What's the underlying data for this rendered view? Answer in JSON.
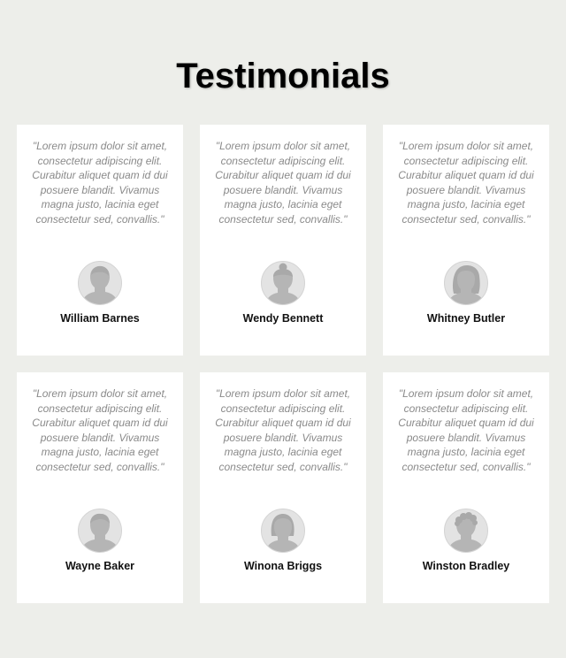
{
  "page": {
    "title": "Testimonials",
    "background_color": "#edeeea"
  },
  "testimonials": [
    {
      "quote": "\"Lorem ipsum dolor sit amet, consectetur adipiscing elit. Curabitur aliquet quam id dui posuere blandit. Vivamus magna justo, lacinia eget consectetur sed, convallis.\"",
      "name": "William Barnes",
      "avatar_icon": "male-silhouette-icon"
    },
    {
      "quote": "\"Lorem ipsum dolor sit amet, consectetur adipiscing elit. Curabitur aliquet quam id dui posuere blandit. Vivamus magna justo, lacinia eget consectetur sed, convallis.\"",
      "name": "Wendy Bennett",
      "avatar_icon": "female-bun-silhouette-icon"
    },
    {
      "quote": "\"Lorem ipsum dolor sit amet, consectetur adipiscing elit. Curabitur aliquet quam id dui posuere blandit. Vivamus magna justo, lacinia eget consectetur sed, convallis.\"",
      "name": "Whitney Butler",
      "avatar_icon": "female-long-hair-silhouette-icon"
    },
    {
      "quote": "\"Lorem ipsum dolor sit amet, consectetur adipiscing elit. Curabitur aliquet quam id dui posuere blandit. Vivamus magna justo, lacinia eget consectetur sed, convallis.\"",
      "name": "Wayne Baker",
      "avatar_icon": "male-silhouette-icon"
    },
    {
      "quote": "\"Lorem ipsum dolor sit amet, consectetur adipiscing elit. Curabitur aliquet quam id dui posuere blandit. Vivamus magna justo, lacinia eget consectetur sed, convallis.\"",
      "name": "Winona Briggs",
      "avatar_icon": "female-bob-silhouette-icon"
    },
    {
      "quote": "\"Lorem ipsum dolor sit amet, consectetur adipiscing elit. Curabitur aliquet quam id dui posuere blandit. Vivamus magna justo, lacinia eget consectetur sed, convallis.\"",
      "name": "Winston Bradley",
      "avatar_icon": "male-curly-hair-silhouette-icon"
    }
  ]
}
